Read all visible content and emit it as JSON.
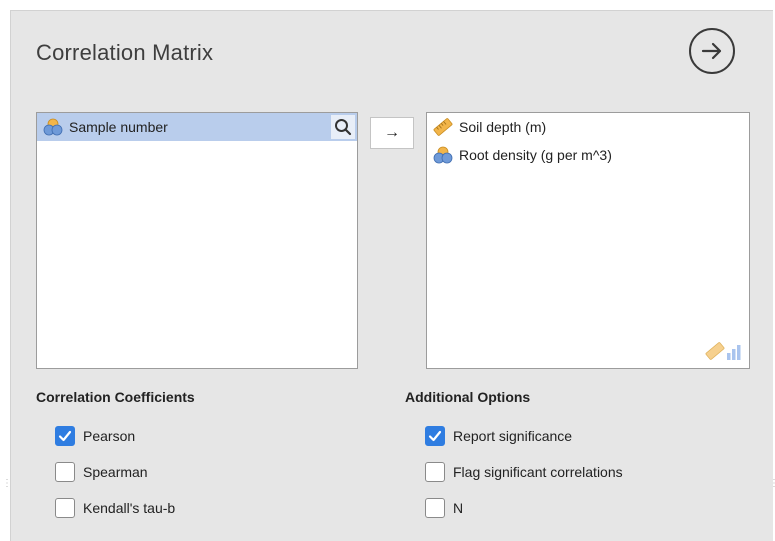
{
  "panel": {
    "title": "Correlation Matrix"
  },
  "source_list": {
    "items": [
      {
        "label": "Sample number",
        "icon": "nominal-variable-icon",
        "selected": true
      }
    ]
  },
  "move_button": {
    "label": "→"
  },
  "target_list": {
    "items": [
      {
        "label": "Soil depth (m)",
        "icon": "continuous-ruler-icon"
      },
      {
        "label": "Root density (g per m^3)",
        "icon": "nominal-variable-icon"
      }
    ]
  },
  "correlation_coefficients": {
    "heading": "Correlation Coefficients",
    "options": [
      {
        "label": "Pearson",
        "checked": true
      },
      {
        "label": "Spearman",
        "checked": false
      },
      {
        "label": "Kendall's tau-b",
        "checked": false
      }
    ]
  },
  "additional_options": {
    "heading": "Additional Options",
    "options": [
      {
        "label": "Report significance",
        "checked": true
      },
      {
        "label": "Flag significant correlations",
        "checked": false
      },
      {
        "label": "N",
        "checked": false
      }
    ]
  },
  "colors": {
    "accent": "#2f7de1",
    "selection": "#b9cdec",
    "panel": "#e6e6e6"
  }
}
